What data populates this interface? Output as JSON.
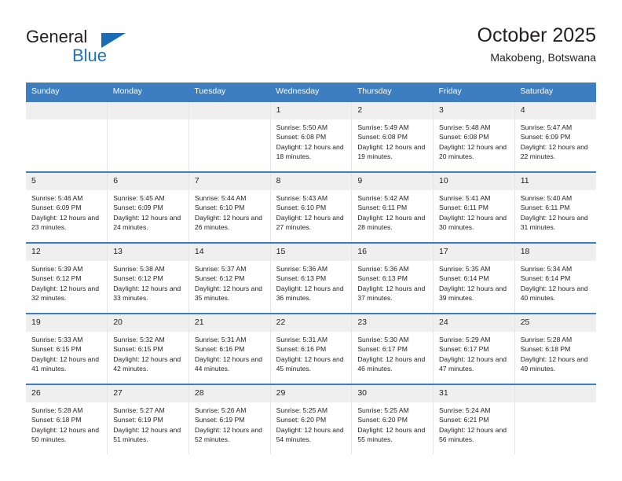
{
  "brand": {
    "name_part1": "General",
    "name_part2": "Blue",
    "triangle_icon": "triangle-icon",
    "accent_color": "#1c75bc"
  },
  "header": {
    "title": "October 2025",
    "subtitle": "Makobeng, Botswana"
  },
  "calendar": {
    "header_bg": "#3c7ebf",
    "daynum_bg": "#efefef",
    "weekdays": [
      "Sunday",
      "Monday",
      "Tuesday",
      "Wednesday",
      "Thursday",
      "Friday",
      "Saturday"
    ],
    "weeks": [
      [
        {
          "day": "",
          "blank": true
        },
        {
          "day": "",
          "blank": true
        },
        {
          "day": "",
          "blank": true
        },
        {
          "day": "1",
          "sunrise": "Sunrise: 5:50 AM",
          "sunset": "Sunset: 6:08 PM",
          "daylight": "Daylight: 12 hours and 18 minutes."
        },
        {
          "day": "2",
          "sunrise": "Sunrise: 5:49 AM",
          "sunset": "Sunset: 6:08 PM",
          "daylight": "Daylight: 12 hours and 19 minutes."
        },
        {
          "day": "3",
          "sunrise": "Sunrise: 5:48 AM",
          "sunset": "Sunset: 6:08 PM",
          "daylight": "Daylight: 12 hours and 20 minutes."
        },
        {
          "day": "4",
          "sunrise": "Sunrise: 5:47 AM",
          "sunset": "Sunset: 6:09 PM",
          "daylight": "Daylight: 12 hours and 22 minutes."
        }
      ],
      [
        {
          "day": "5",
          "sunrise": "Sunrise: 5:46 AM",
          "sunset": "Sunset: 6:09 PM",
          "daylight": "Daylight: 12 hours and 23 minutes."
        },
        {
          "day": "6",
          "sunrise": "Sunrise: 5:45 AM",
          "sunset": "Sunset: 6:09 PM",
          "daylight": "Daylight: 12 hours and 24 minutes."
        },
        {
          "day": "7",
          "sunrise": "Sunrise: 5:44 AM",
          "sunset": "Sunset: 6:10 PM",
          "daylight": "Daylight: 12 hours and 26 minutes."
        },
        {
          "day": "8",
          "sunrise": "Sunrise: 5:43 AM",
          "sunset": "Sunset: 6:10 PM",
          "daylight": "Daylight: 12 hours and 27 minutes."
        },
        {
          "day": "9",
          "sunrise": "Sunrise: 5:42 AM",
          "sunset": "Sunset: 6:11 PM",
          "daylight": "Daylight: 12 hours and 28 minutes."
        },
        {
          "day": "10",
          "sunrise": "Sunrise: 5:41 AM",
          "sunset": "Sunset: 6:11 PM",
          "daylight": "Daylight: 12 hours and 30 minutes."
        },
        {
          "day": "11",
          "sunrise": "Sunrise: 5:40 AM",
          "sunset": "Sunset: 6:11 PM",
          "daylight": "Daylight: 12 hours and 31 minutes."
        }
      ],
      [
        {
          "day": "12",
          "sunrise": "Sunrise: 5:39 AM",
          "sunset": "Sunset: 6:12 PM",
          "daylight": "Daylight: 12 hours and 32 minutes."
        },
        {
          "day": "13",
          "sunrise": "Sunrise: 5:38 AM",
          "sunset": "Sunset: 6:12 PM",
          "daylight": "Daylight: 12 hours and 33 minutes."
        },
        {
          "day": "14",
          "sunrise": "Sunrise: 5:37 AM",
          "sunset": "Sunset: 6:12 PM",
          "daylight": "Daylight: 12 hours and 35 minutes."
        },
        {
          "day": "15",
          "sunrise": "Sunrise: 5:36 AM",
          "sunset": "Sunset: 6:13 PM",
          "daylight": "Daylight: 12 hours and 36 minutes."
        },
        {
          "day": "16",
          "sunrise": "Sunrise: 5:36 AM",
          "sunset": "Sunset: 6:13 PM",
          "daylight": "Daylight: 12 hours and 37 minutes."
        },
        {
          "day": "17",
          "sunrise": "Sunrise: 5:35 AM",
          "sunset": "Sunset: 6:14 PM",
          "daylight": "Daylight: 12 hours and 39 minutes."
        },
        {
          "day": "18",
          "sunrise": "Sunrise: 5:34 AM",
          "sunset": "Sunset: 6:14 PM",
          "daylight": "Daylight: 12 hours and 40 minutes."
        }
      ],
      [
        {
          "day": "19",
          "sunrise": "Sunrise: 5:33 AM",
          "sunset": "Sunset: 6:15 PM",
          "daylight": "Daylight: 12 hours and 41 minutes."
        },
        {
          "day": "20",
          "sunrise": "Sunrise: 5:32 AM",
          "sunset": "Sunset: 6:15 PM",
          "daylight": "Daylight: 12 hours and 42 minutes."
        },
        {
          "day": "21",
          "sunrise": "Sunrise: 5:31 AM",
          "sunset": "Sunset: 6:16 PM",
          "daylight": "Daylight: 12 hours and 44 minutes."
        },
        {
          "day": "22",
          "sunrise": "Sunrise: 5:31 AM",
          "sunset": "Sunset: 6:16 PM",
          "daylight": "Daylight: 12 hours and 45 minutes."
        },
        {
          "day": "23",
          "sunrise": "Sunrise: 5:30 AM",
          "sunset": "Sunset: 6:17 PM",
          "daylight": "Daylight: 12 hours and 46 minutes."
        },
        {
          "day": "24",
          "sunrise": "Sunrise: 5:29 AM",
          "sunset": "Sunset: 6:17 PM",
          "daylight": "Daylight: 12 hours and 47 minutes."
        },
        {
          "day": "25",
          "sunrise": "Sunrise: 5:28 AM",
          "sunset": "Sunset: 6:18 PM",
          "daylight": "Daylight: 12 hours and 49 minutes."
        }
      ],
      [
        {
          "day": "26",
          "sunrise": "Sunrise: 5:28 AM",
          "sunset": "Sunset: 6:18 PM",
          "daylight": "Daylight: 12 hours and 50 minutes."
        },
        {
          "day": "27",
          "sunrise": "Sunrise: 5:27 AM",
          "sunset": "Sunset: 6:19 PM",
          "daylight": "Daylight: 12 hours and 51 minutes."
        },
        {
          "day": "28",
          "sunrise": "Sunrise: 5:26 AM",
          "sunset": "Sunset: 6:19 PM",
          "daylight": "Daylight: 12 hours and 52 minutes."
        },
        {
          "day": "29",
          "sunrise": "Sunrise: 5:25 AM",
          "sunset": "Sunset: 6:20 PM",
          "daylight": "Daylight: 12 hours and 54 minutes."
        },
        {
          "day": "30",
          "sunrise": "Sunrise: 5:25 AM",
          "sunset": "Sunset: 6:20 PM",
          "daylight": "Daylight: 12 hours and 55 minutes."
        },
        {
          "day": "31",
          "sunrise": "Sunrise: 5:24 AM",
          "sunset": "Sunset: 6:21 PM",
          "daylight": "Daylight: 12 hours and 56 minutes."
        },
        {
          "day": "",
          "blank": true
        }
      ]
    ]
  }
}
